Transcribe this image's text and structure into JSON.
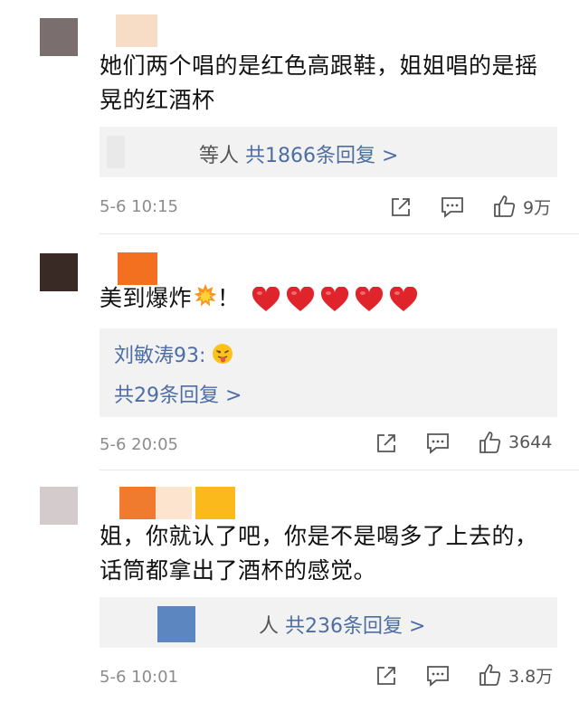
{
  "colors": {
    "link": "#4e6ea3",
    "meta": "#8c8c8c",
    "reply_bg": "#f2f2f2",
    "heart": "#e0242c"
  },
  "comments": [
    {
      "avatar_color": "#7a6e6e",
      "name_colors": [
        "#f7dcc6"
      ],
      "text": "她们两个唱的是红色高跟鞋，姐姐唱的是摇晃的红酒杯",
      "reply_prefix": "等人",
      "reply_count_text": "共1866条回复 >",
      "time": "5-6 10:15",
      "likes": "9万",
      "icons": [
        "share-icon",
        "comment-icon",
        "like-icon"
      ]
    },
    {
      "avatar_color": "#3a2a26",
      "name_colors": [
        "#f37021"
      ],
      "text": "美到爆炸",
      "text_suffix": "！",
      "emoji": [
        "collision-emoji",
        "heart-emoji",
        "heart-emoji",
        "heart-emoji",
        "heart-emoji",
        "heart-emoji"
      ],
      "reply_author": "刘敏涛93:",
      "reply_emoji": "tongue-face-emoji",
      "reply_count_text": "共29条回复 >",
      "time": "5-6 20:05",
      "likes": "3644",
      "icons": [
        "share-icon",
        "comment-icon",
        "like-icon"
      ]
    },
    {
      "avatar_color": "#d4cccc",
      "name_colors": [
        "#f07a2d",
        "#fce4cf",
        "#fbb91b"
      ],
      "text": "姐，你就认了吧，你是不是喝多了上去的，话筒都拿出了酒杯的感觉。",
      "reply_prefix": "人",
      "reply_count_text": "共236条回复 >",
      "reply_avatar_color": "#5b86c0",
      "time": "5-6 10:01",
      "likes": "3.8万",
      "icons": [
        "share-icon",
        "comment-icon",
        "like-icon"
      ]
    }
  ]
}
